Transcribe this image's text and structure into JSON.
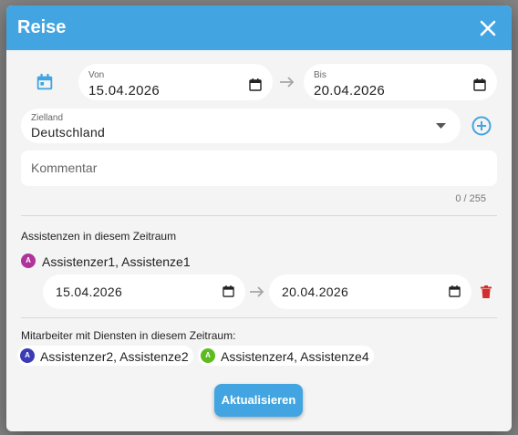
{
  "dialog": {
    "title": "Reise",
    "date_from": {
      "label": "Von",
      "value": "15.04.2026"
    },
    "date_to": {
      "label": "Bis",
      "value": "20.04.2026"
    },
    "country": {
      "label": "Zielland",
      "value": "Deutschland"
    },
    "comment": {
      "placeholder": "Kommentar",
      "counter": "0 / 255"
    },
    "assistants_heading": "Assistenzen in diesem Zeitraum",
    "assistant": {
      "avatar_letter": "A",
      "avatar_color": "#b0329b",
      "name": "Assistenzer1, Assistenze1",
      "from": "15.04.2026",
      "to": "20.04.2026"
    },
    "staff_heading": "Mitarbeiter mit Diensten in diesem Zeitraum:",
    "staff": [
      {
        "avatar_letter": "A",
        "avatar_color": "#3b3bb6",
        "name": "Assistenzer2, Assistenze2"
      },
      {
        "avatar_letter": "A",
        "avatar_color": "#5dbb1f",
        "name": "Assistenzer4, Assistenze4"
      }
    ],
    "submit_label": "Aktualisieren"
  },
  "colors": {
    "accent": "#42a5e1",
    "delete": "#d32f2f"
  },
  "icons": [
    "calendar-icon",
    "close-icon",
    "arrow-right-icon",
    "dropdown-arrow-icon",
    "add-circle-icon",
    "delete-icon"
  ]
}
